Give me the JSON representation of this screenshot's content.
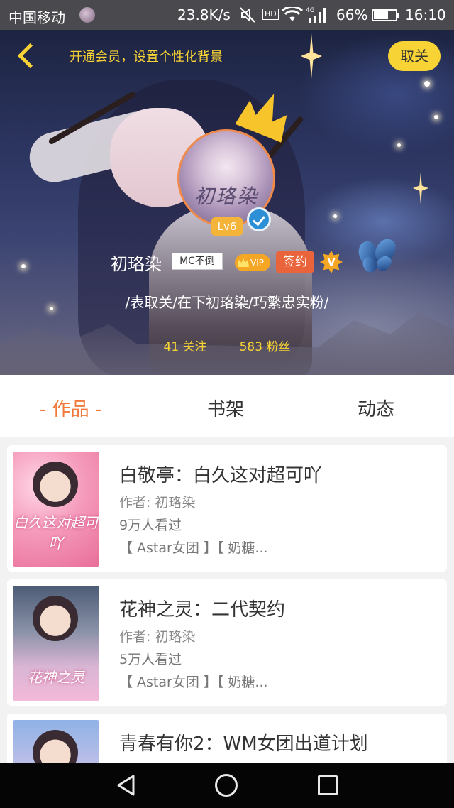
{
  "status_bar": {
    "carrier": "中国移动",
    "net_speed": "23.8K/s",
    "hd_label": "HD",
    "signal_label": "4G",
    "battery_percent": "66%",
    "battery_level": 0.66,
    "time": "16:10"
  },
  "header": {
    "vip_banner": "开通会员，设置个性化背景",
    "unfollow_label": "取关"
  },
  "profile": {
    "avatar_text": "初珞染",
    "level": "Lv6",
    "username": "初珞染",
    "mc_tag": "MC不倒",
    "vip_label": "VIP",
    "signed_label": "签约",
    "v_medal": "V",
    "signature": "/表取关/在下初珞染/巧繁忠实粉/",
    "following": "41 关注",
    "followers": "583 粉丝"
  },
  "tabs": [
    {
      "label": "- 作品 -",
      "active": true
    },
    {
      "label": "书架",
      "active": false
    },
    {
      "label": "动态",
      "active": false
    }
  ],
  "books": [
    {
      "title": "白敬亭：白久这对超可吖",
      "author": "作者: 初珞染",
      "reads": "9万人看过",
      "tags": "【 Astar女团 】【 奶糖...",
      "cover_text": "白久这对超可吖"
    },
    {
      "title": "花神之灵：二代契约",
      "author": "作者: 初珞染",
      "reads": "5万人看过",
      "tags": "【 Astar女团 】【 奶糖...",
      "cover_text": "花神之灵"
    },
    {
      "title": "青春有你2：WM女团出道计划",
      "author": "",
      "reads": "",
      "tags": "",
      "cover_text": ""
    }
  ],
  "colors": {
    "accent_yellow": "#f7d335",
    "active_tab": "#f0793b",
    "signed_badge": "#e9643a",
    "verified_blue": "#2d8fd6"
  }
}
